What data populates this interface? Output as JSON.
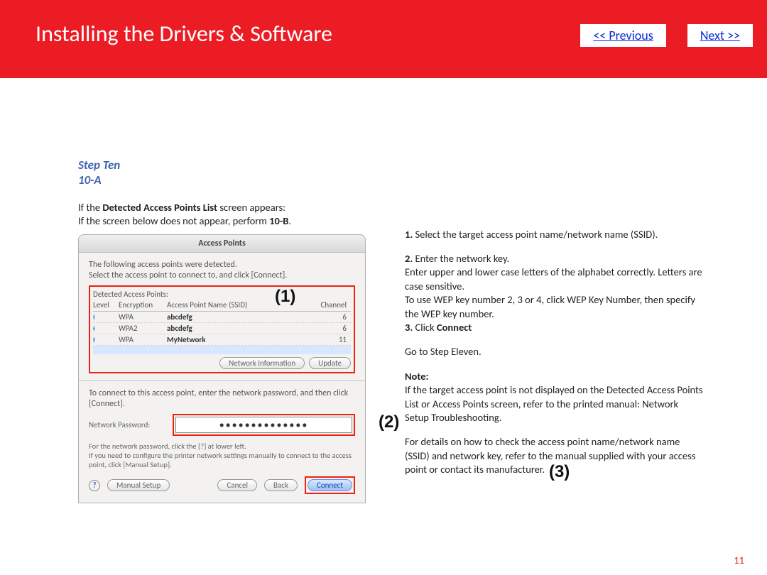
{
  "banner": {
    "title": "Installing  the Drivers & Software",
    "prev": "<< Previous",
    "next": "Next >>"
  },
  "step": {
    "line1": "Step Ten",
    "line2": "10-A"
  },
  "intro": {
    "l1a": "If the ",
    "l1b": "Detected Access Points List",
    "l1c": " screen appears:",
    "l2a": "If the screen below does not appear, perform ",
    "l2b": "10-B",
    "l2c": "."
  },
  "dialog": {
    "title": "Access Points",
    "detected1": "The following access points were detected.",
    "detected2": "Select the access point to connect to, and click [Connect].",
    "table_label": "Detected Access Points:",
    "head": {
      "level": "Level",
      "enc": "Encryption",
      "ssid": "Access Point Name (SSID)",
      "chan": "Channel"
    },
    "rows": [
      {
        "enc": "WPA",
        "ssid": "abcdefg",
        "chan": "6"
      },
      {
        "enc": "WPA2",
        "ssid": "abcdefg",
        "chan": "6"
      },
      {
        "enc": "WPA",
        "ssid": "MyNetwork",
        "chan": "11"
      }
    ],
    "netinfo_btn": "Network Information",
    "update_btn": "Update",
    "connect_hint": "To connect to this access point, enter the network password, and then click [Connect].",
    "pwd_label": "Network Password:",
    "pwd_value": "••••••••••••••",
    "note1": "For the network password, click the [?] at lower left.",
    "note2": "If you need to configure the printer network settings manually to connect to the access point, click [Manual Setup].",
    "help": "?",
    "manual_btn": "Manual Setup",
    "cancel_btn": "Cancel",
    "back_btn": "Back",
    "connect_btn": "Connect",
    "callout1": "(1)",
    "callout2": "(2)",
    "callout3": "(3)"
  },
  "right": {
    "p1a": "1.",
    "p1b": " Select the target access point name/network name (SSID).",
    "p2a": "2.",
    "p2b": " Enter the network key.",
    "p2c": "Enter upper and lower case letters of the alphabet correctly. Letters are case sensitive.",
    "p2d": "To use WEP key number 2, 3 or 4, click WEP Key Number, then specify the WEP key number.",
    "p3a": "3.",
    "p3b": "  Click ",
    "p3c": "Connect",
    "p4": "Go to Step Eleven.",
    "note_label": "Note:",
    "note1": "If the target access point is not displayed on the Detected Access Points List or Access Points screen, refer to the printed manual: Network Setup Troubleshooting.",
    "note2": "For details on how to check the access point name/network name (SSID) and network key, refer to the manual supplied with your access point or contact its manufacturer."
  },
  "page_num": "11"
}
